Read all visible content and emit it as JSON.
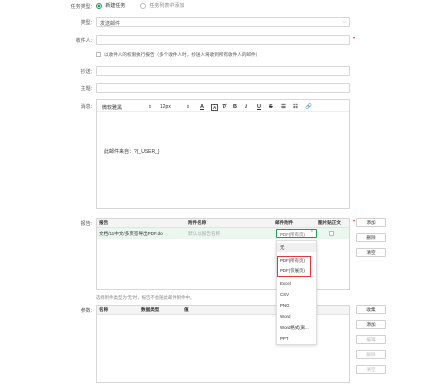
{
  "task_type": {
    "label": "任务类型:",
    "option_new": "新建任务",
    "option_add": "任务列表中添加"
  },
  "fields": {
    "type_label": "类型:",
    "type_value": "发送邮件",
    "recipient_label": "收件人:",
    "permission_checkbox_text": "以收件人的权限执行报告（多个收件人时，抄送人将收到所有收件人的邮件）",
    "cc_label": "抄送:",
    "subject_label": "主题:",
    "message_label": "消息:"
  },
  "editor": {
    "font_family": "微软雅黑",
    "font_size": "12px",
    "body_text": "此邮件来自：?{_USER_}"
  },
  "report": {
    "label": "报告:",
    "headers": [
      "报告",
      "附件名称",
      "邮件附件",
      "图片贴正文"
    ],
    "row": {
      "report_name": "文档/11中文/多页签导出PDF.do",
      "attachment_placeholder": "默认以报告名称",
      "attachment_type": "PDF(所有页)"
    },
    "note": "选择附件类型为'无'时，报告不会随此邮件附件中。"
  },
  "attachment_menu": {
    "options": [
      "无",
      "PDF(所有页)",
      "PDF(仅展页)",
      "Excel",
      "CSV",
      "PNG",
      "Word",
      "Word格式(离...",
      "PPT"
    ]
  },
  "params": {
    "label": "参数:",
    "headers": [
      "名称",
      "数据类型",
      "值"
    ]
  },
  "buttons": {
    "report_add": "添加",
    "report_delete": "删除",
    "report_clear": "清空",
    "param_collect": "收集",
    "param_add": "添加",
    "param_edit": "编辑",
    "param_delete": "删除",
    "param_clear": "清空"
  },
  "colors": {
    "accent": "#1e9e5a",
    "required": "#e4393c",
    "highlight": "#e4393c"
  }
}
